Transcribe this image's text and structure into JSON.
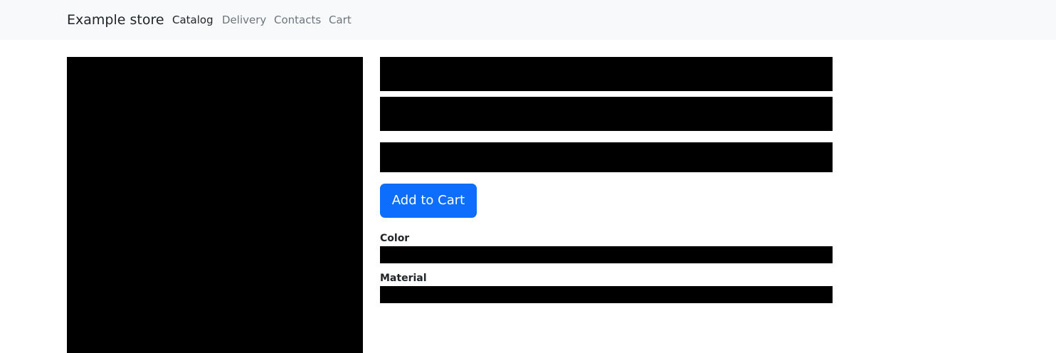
{
  "navbar": {
    "brand": "Example store",
    "links": [
      {
        "label": "Catalog",
        "active": true
      },
      {
        "label": "Delivery",
        "active": false
      },
      {
        "label": "Contacts",
        "active": false
      },
      {
        "label": "Cart",
        "active": false
      }
    ]
  },
  "product": {
    "add_to_cart_label": "Add to Cart",
    "attributes": [
      {
        "label": "Color"
      },
      {
        "label": "Material"
      }
    ]
  },
  "colors": {
    "navbar_bg": "#f8f9fa",
    "primary": "#0d6efd",
    "redacted": "#000000",
    "link_muted": "#6c757d",
    "text": "#212529"
  }
}
